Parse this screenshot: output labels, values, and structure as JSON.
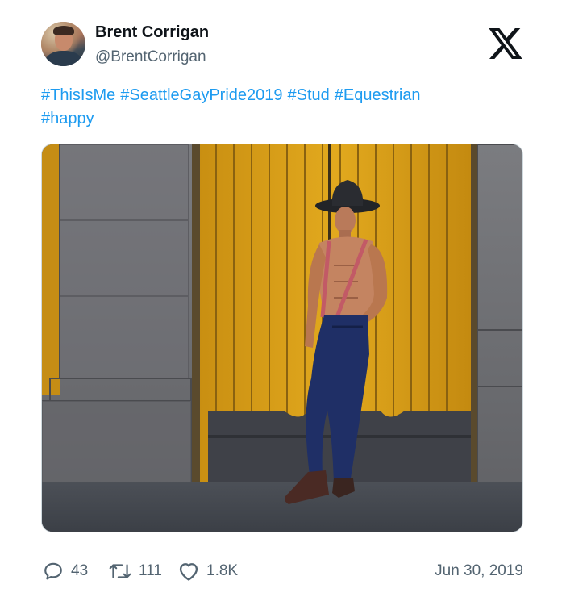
{
  "author": {
    "name": "Brent Corrigan",
    "handle": "@BrentCorrigan"
  },
  "brand_icon": "x-logo-icon",
  "tweet": {
    "hashtags": [
      "#ThisIsMe",
      "#SeattleGayPride2019",
      "#Stud",
      "#Equestrian",
      "#happy"
    ],
    "link_color": "#1d9bf0"
  },
  "media": {
    "icon": "photo-icon"
  },
  "stats": {
    "replies": "43",
    "retweets": "111",
    "likes": "1.8K"
  },
  "date": "Jun 30, 2019",
  "colors": {
    "text": "#0f1419",
    "muted": "#536471"
  }
}
